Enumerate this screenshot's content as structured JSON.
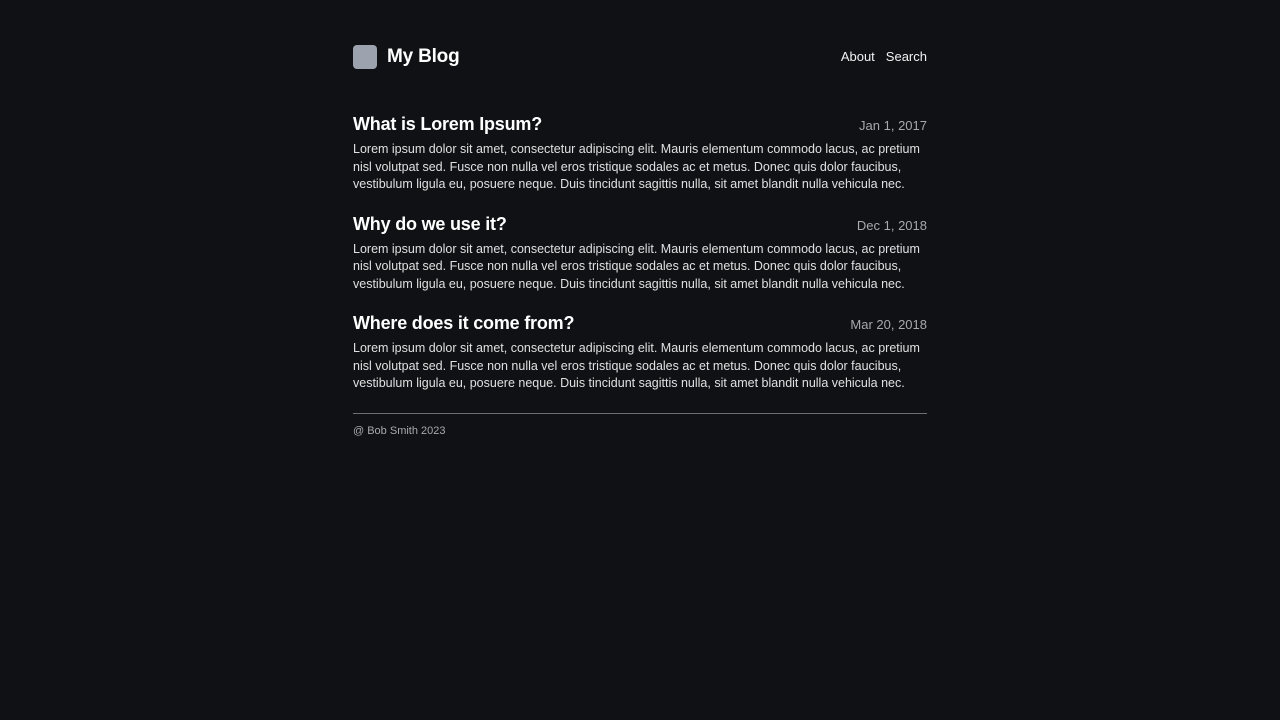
{
  "header": {
    "logo_icon": "square-logo-icon",
    "title": "My Blog",
    "nav": [
      {
        "label": "About"
      },
      {
        "label": "Search"
      }
    ]
  },
  "posts": [
    {
      "title": "What is Lorem Ipsum?",
      "date": "Jan 1, 2017",
      "excerpt": "Lorem ipsum dolor sit amet, consectetur adipiscing elit. Mauris elementum commodo lacus, ac pretium nisl volutpat sed. Fusce non nulla vel eros tristique sodales ac et metus. Donec quis dolor faucibus, vestibulum ligula eu, posuere neque. Duis tincidunt sagittis nulla, sit amet blandit nulla vehicula nec."
    },
    {
      "title": "Why do we use it?",
      "date": "Dec 1, 2018",
      "excerpt": "Lorem ipsum dolor sit amet, consectetur adipiscing elit. Mauris elementum commodo lacus, ac pretium nisl volutpat sed. Fusce non nulla vel eros tristique sodales ac et metus. Donec quis dolor faucibus, vestibulum ligula eu, posuere neque. Duis tincidunt sagittis nulla, sit amet blandit nulla vehicula nec."
    },
    {
      "title": "Where does it come from?",
      "date": "Mar 20, 2018",
      "excerpt": "Lorem ipsum dolor sit amet, consectetur adipiscing elit. Mauris elementum commodo lacus, ac pretium nisl volutpat sed. Fusce non nulla vel eros tristique sodales ac et metus. Donec quis dolor faucibus, vestibulum ligula eu, posuere neque. Duis tincidunt sagittis nulla, sit amet blandit nulla vehicula nec."
    }
  ],
  "footer": {
    "copyright": "@ Bob Smith 2023"
  },
  "colors": {
    "background": "#0f1115",
    "logo": "#9ca3af",
    "divider": "#6b6e73",
    "muted_text": "#a7a9ad"
  }
}
